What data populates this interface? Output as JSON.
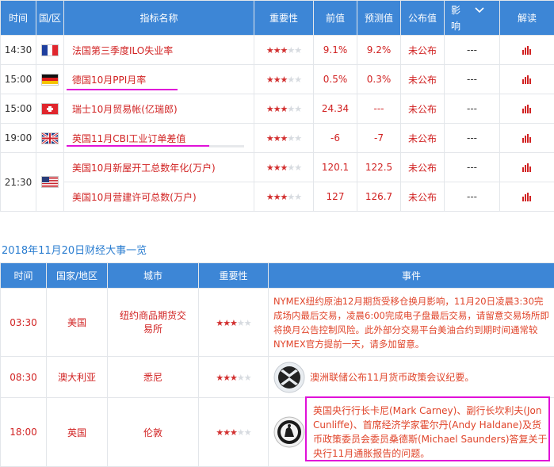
{
  "top_table": {
    "headers": [
      "时间",
      "国/区",
      "指标名称",
      "重要性",
      "前值",
      "预测值",
      "公布值",
      "影\n响",
      "解读"
    ],
    "impact_header": [
      "影",
      "响"
    ],
    "rows": [
      {
        "time": "14:30",
        "flag": "france",
        "name": "法国第三季度ILO失业率",
        "stars": 3,
        "prev": "9.1%",
        "forecast": "9.2%",
        "actual": "未公布",
        "impact": "---",
        "name_color": "red"
      },
      {
        "time": "15:00",
        "flag": "germany",
        "name": "德国10月PPI月率",
        "stars": 3,
        "prev": "0.5%",
        "forecast": "0.3%",
        "actual": "未公布",
        "impact": "---",
        "name_color": "red"
      },
      {
        "time": "15:00",
        "flag": "switzerland",
        "name": "瑞士10月贸易帐(亿瑞郎)",
        "stars": 3,
        "prev": "24.34",
        "forecast": "---",
        "actual": "未公布",
        "impact": "---",
        "name_color": "red"
      },
      {
        "time": "19:00",
        "flag": "uk",
        "name": "英国11月CBI工业订单差值",
        "stars": 3,
        "prev": "-6",
        "forecast": "-7",
        "actual": "未公布",
        "impact": "---",
        "name_color": "red"
      },
      {
        "time": "21:30",
        "flag": "usa",
        "name": "美国10月新屋开工总数年化(万户)",
        "stars": 3,
        "prev": "120.1",
        "forecast": "122.5",
        "actual": "未公布",
        "impact": "---",
        "name_color": "red"
      },
      {
        "time": "",
        "flag": "",
        "name": "美国10月营建许可总数(万户)",
        "stars": 3,
        "prev": "127",
        "forecast": "126.7",
        "actual": "未公布",
        "impact": "---",
        "name_color": "red"
      }
    ]
  },
  "section_title": "2018年11月20日财经大事一览",
  "events_table": {
    "headers": [
      "时间",
      "国家/地区",
      "城市",
      "重要性",
      "事件"
    ],
    "rows": [
      {
        "time": "03:30",
        "country": "美国",
        "city": "纽约商品期货交易所",
        "stars": 3,
        "event": "NYMEX纽约原油12月期货受移仓换月影响，11月20日凌晨3:30完成场内最后交易，凌晨6:00完成电子盘最后交易，请留意交易场所即将换月公告控制风险。此外部分交易平台美油合约到期时间通常较NYMEX官方提前一天，请多加留意。",
        "logo": ""
      },
      {
        "time": "08:30",
        "country": "澳大利亚",
        "city": "悉尼",
        "stars": 3,
        "event": "澳洲联储公布11月货币政策会议纪要。",
        "logo": "rba-logo"
      },
      {
        "time": "18:00",
        "country": "英国",
        "city": "伦敦",
        "stars": 3,
        "event": "英国央行行长卡尼(Mark Carney)、副行长坎利夫(Jon Cunliffe)、首席经济学家霍尔丹(Andy Haldane)及货币政策委员会委员桑德斯(Michael Saunders)答复关于央行11月通胀报告的问题。",
        "logo": "boe-logo"
      }
    ]
  },
  "colors": {
    "header_bg": "#3d86d6",
    "red_text": "#d12222",
    "highlight": "#e011d8",
    "link_blue": "#2a7dd0"
  }
}
